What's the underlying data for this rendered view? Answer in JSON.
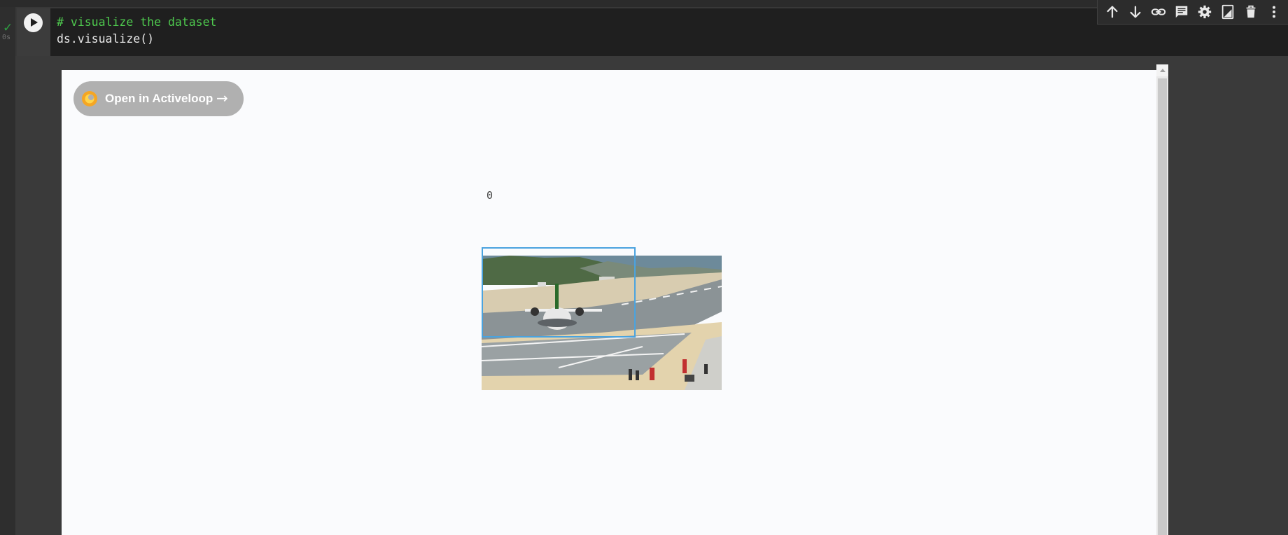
{
  "cell": {
    "status": "✓",
    "exec_time": "0s",
    "code_comment": "# visualize the dataset",
    "code_statement": "ds.visualize()"
  },
  "toolbar": {
    "icons": [
      "arrow-up-icon",
      "arrow-down-icon",
      "link-icon",
      "comment-icon",
      "gear-icon",
      "mirror-cell-icon",
      "trash-icon",
      "more-vert-icon"
    ]
  },
  "output": {
    "open_button_label": "Open in Activeloop",
    "open_button_arrow": "→",
    "sample_index": "0",
    "bbox_color": "#4aa3df",
    "logo_colors": [
      "#f5a623",
      "#ffd54a"
    ]
  }
}
